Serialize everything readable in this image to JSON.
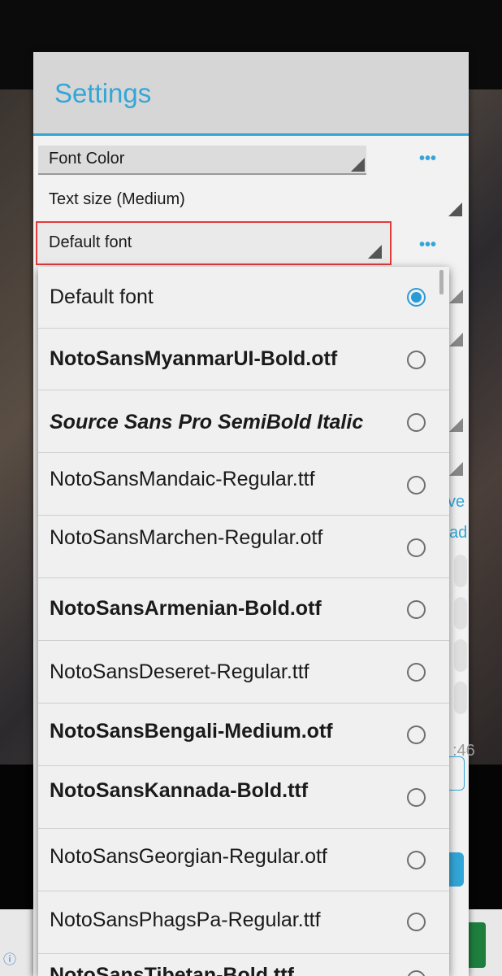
{
  "dialog": {
    "title": "Settings",
    "rows": {
      "font_color": "Font Color",
      "text_size": "Text size (Medium)",
      "default_font": "Default font"
    },
    "more_glyph": "•••"
  },
  "background": {
    "peek_texts": [
      "ve",
      "ad",
      ":46"
    ]
  },
  "font_popup": {
    "selected": "Default font",
    "items": [
      {
        "label": "Default font",
        "checked": true
      },
      {
        "label": "NotoSansMyanmarUI-Bold.otf",
        "checked": false
      },
      {
        "label": "Source Sans Pro SemiBold Italic",
        "checked": false
      },
      {
        "label": "NotoSansMandaic-Regular.ttf",
        "checked": false
      },
      {
        "label": "NotoSansMarchen-Regular.otf",
        "checked": false
      },
      {
        "label": "NotoSansArmenian-Bold.otf",
        "checked": false
      },
      {
        "label": "NotoSansDeseret-Regular.ttf",
        "checked": false
      },
      {
        "label": "NotoSansBengali-Medium.otf",
        "checked": false
      },
      {
        "label": "NotoSansKannada-Bold.ttf",
        "checked": false
      },
      {
        "label": "NotoSansGeorgian-Regular.otf",
        "checked": false
      },
      {
        "label": "NotoSansPhagsPa-Regular.ttf",
        "checked": false
      },
      {
        "label": "NotoSansTibetan-Bold.ttf",
        "checked": false
      }
    ]
  },
  "colors": {
    "accent": "#33a6d8",
    "focus_border": "#e53a3a"
  }
}
